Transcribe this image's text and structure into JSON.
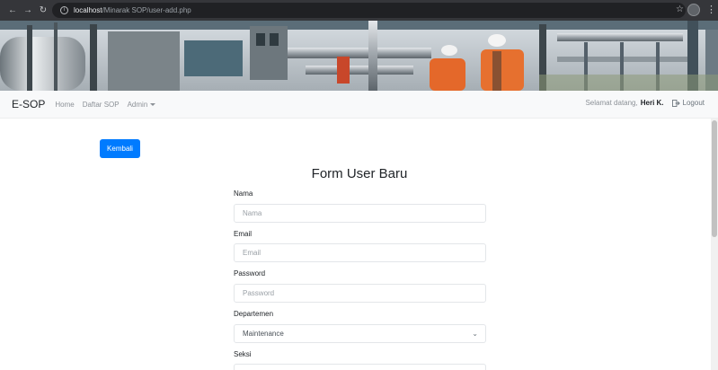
{
  "browser": {
    "url_host": "localhost",
    "url_path": "/Minarak SOP/user-add.php",
    "icons": [
      "back-arrow-icon",
      "forward-arrow-icon",
      "reload-icon",
      "info-icon",
      "star-icon",
      "profile-icon",
      "kebab-menu-icon"
    ]
  },
  "navbar": {
    "brand": "E-SOP",
    "links": [
      "Home",
      "Daftar SOP",
      "Admin"
    ],
    "welcome_text": "Selamat datang,",
    "username": "Heri K.",
    "logout_label": "Logout"
  },
  "main": {
    "back_button": "Kembali",
    "form_title": "Form User Baru",
    "fields": [
      {
        "label": "Nama",
        "placeholder": "Nama"
      },
      {
        "label": "Email",
        "placeholder": "Email"
      },
      {
        "label": "Password",
        "placeholder": "Password"
      },
      {
        "label": "Departemen",
        "value": "Maintenance"
      },
      {
        "label": "Seksi",
        "value": ""
      }
    ]
  },
  "colors": {
    "primary": "#007bff",
    "navbar_bg": "#f8f9fa",
    "chrome_bg": "#35363a"
  }
}
